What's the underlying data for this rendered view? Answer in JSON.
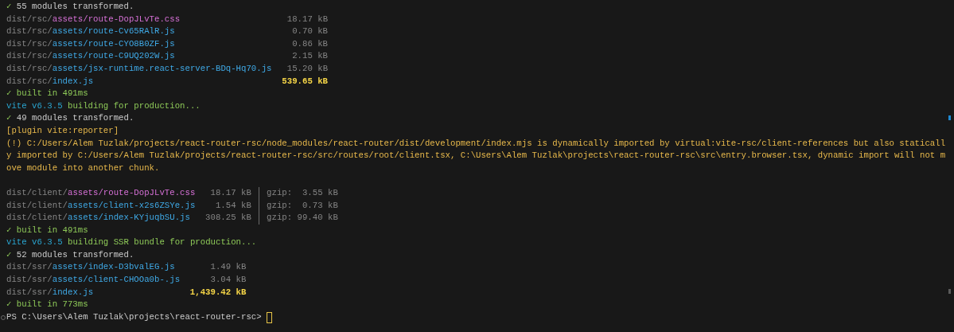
{
  "lines": [
    {
      "kind": "status",
      "mark": "✓",
      "text": "55 modules transformed."
    },
    {
      "kind": "file_table",
      "rows": [
        {
          "dir": "dist/rsc/",
          "path": "assets/route-DopJLvTe.css",
          "kind": "css",
          "size": "18.17 kB",
          "large": false
        },
        {
          "dir": "dist/rsc/",
          "path": "assets/route-Cv65RAlR.js",
          "kind": "js",
          "size": "0.70 kB",
          "large": false
        },
        {
          "dir": "dist/rsc/",
          "path": "assets/route-CYO8B0ZF.js",
          "kind": "js",
          "size": "0.86 kB",
          "large": false
        },
        {
          "dir": "dist/rsc/",
          "path": "assets/route-C9UQ202W.js",
          "kind": "js",
          "size": "2.15 kB",
          "large": false
        },
        {
          "dir": "dist/rsc/",
          "path": "assets/jsx-runtime.react-server-BDq-Hq70.js",
          "kind": "js",
          "size": "15.20 kB",
          "large": false
        },
        {
          "dir": "dist/rsc/",
          "path": "index.js",
          "kind": "js",
          "size": "539.65 kB",
          "large": true
        }
      ]
    },
    {
      "kind": "done",
      "mark": "✓",
      "text": "built in 491ms"
    },
    {
      "kind": "build_start",
      "tool": "vite v6.3.5",
      "text": "building for production..."
    },
    {
      "kind": "status",
      "mark": "✓",
      "text": "49 modules transformed."
    },
    {
      "kind": "warning",
      "text": "[plugin vite:reporter]"
    },
    {
      "kind": "warning",
      "text": "(!) C:/Users/Alem Tuzlak/projects/react-router-rsc/node_modules/react-router/dist/development/index.mjs is dynamically imported by virtual:vite-rsc/client-references but also staticall"
    },
    {
      "kind": "warning",
      "text": "y imported by C:/Users/Alem Tuzlak/projects/react-router-rsc/src/routes/root/client.tsx, C:\\Users\\Alem Tuzlak\\projects\\react-router-rsc\\src\\entry.browser.tsx, dynamic import will not m"
    },
    {
      "kind": "warning",
      "text": "ove module into another chunk."
    },
    {
      "kind": "blank"
    },
    {
      "kind": "file_table",
      "rows": [
        {
          "dir": "dist/client/",
          "path": "assets/route-DopJLvTe.css",
          "kind": "css",
          "size": "18.17 kB",
          "large": false,
          "gzip_label": "gzip:",
          "gzip": "3.55 kB"
        },
        {
          "dir": "dist/client/",
          "path": "assets/client-x2s6ZSYe.js",
          "kind": "js",
          "size": "1.54 kB",
          "large": false,
          "gzip_label": "gzip:",
          "gzip": "0.73 kB"
        },
        {
          "dir": "dist/client/",
          "path": "assets/index-KYjuqbSU.js",
          "kind": "js",
          "size": "308.25 kB",
          "large": false,
          "gzip_label": "gzip:",
          "gzip": "99.40 kB"
        }
      ]
    },
    {
      "kind": "done",
      "mark": "✓",
      "text": "built in 491ms"
    },
    {
      "kind": "build_start",
      "tool": "vite v6.3.5",
      "text": "building SSR bundle for production..."
    },
    {
      "kind": "status",
      "mark": "✓",
      "text": "52 modules transformed."
    },
    {
      "kind": "file_table",
      "rows": [
        {
          "dir": "dist/ssr/",
          "path": "assets/index-D3bvalEG.js",
          "kind": "js",
          "size": "1.49 kB",
          "large": false
        },
        {
          "dir": "dist/ssr/",
          "path": "assets/client-CHOOa0b-.js",
          "kind": "js",
          "size": "3.04 kB",
          "large": false
        },
        {
          "dir": "dist/ssr/",
          "path": "index.js",
          "kind": "js",
          "size": "1,439.42 kB",
          "large": true
        }
      ]
    },
    {
      "kind": "done",
      "mark": "✓",
      "text": "built in 773ms"
    },
    {
      "kind": "prompt",
      "text": "PS C:\\Users\\Alem Tuzlak\\projects\\react-router-rsc>"
    }
  ]
}
